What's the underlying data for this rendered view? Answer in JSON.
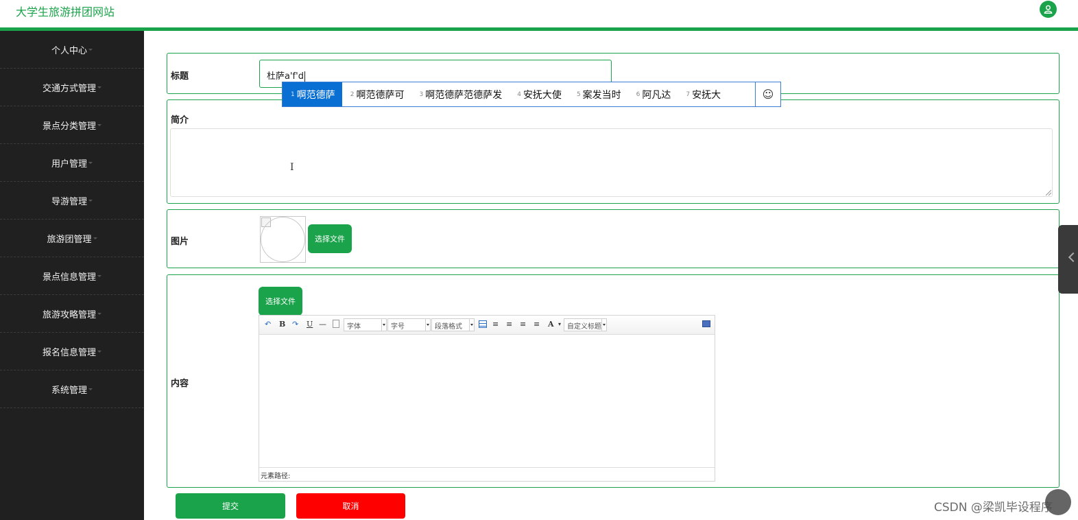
{
  "header": {
    "site_title": "大学生旅游拼团网站",
    "avatar_icon": "user-icon",
    "accent": "#1aa34a"
  },
  "sidebar": {
    "items": [
      {
        "label": "个人中心"
      },
      {
        "label": "交通方式管理"
      },
      {
        "label": "景点分类管理"
      },
      {
        "label": "用户管理"
      },
      {
        "label": "导游管理"
      },
      {
        "label": "旅游团管理"
      },
      {
        "label": "景点信息管理"
      },
      {
        "label": "旅游攻略管理"
      },
      {
        "label": "报名信息管理"
      },
      {
        "label": "系统管理"
      }
    ]
  },
  "form": {
    "title": {
      "label": "标题",
      "value_committed": "杜萨",
      "value_composing": "a'f'd"
    },
    "intro": {
      "label": "简介",
      "value": ""
    },
    "image": {
      "label": "图片",
      "button": "选择文件"
    },
    "content": {
      "label": "内容",
      "upload_button": "选择文件",
      "toolbar": {
        "bold": "B",
        "underline": "U",
        "hr": "—",
        "font_family": "字体",
        "font_size": "字号",
        "paragraph": "段落格式",
        "font_color": "A",
        "custom_heading": "自定义标题"
      },
      "element_path": "元素路径:"
    }
  },
  "ime": {
    "candidates": [
      {
        "num": "1",
        "text": "啊范德萨"
      },
      {
        "num": "2",
        "text": "啊范德萨可"
      },
      {
        "num": "3",
        "text": "啊范德萨范德萨发"
      },
      {
        "num": "4",
        "text": "安抚大使"
      },
      {
        "num": "5",
        "text": "案发当时"
      },
      {
        "num": "6",
        "text": "阿凡达"
      },
      {
        "num": "7",
        "text": "安抚大"
      }
    ],
    "emoji_icon": "☺"
  },
  "actions": {
    "submit": "提交",
    "cancel": "取消"
  },
  "watermark": "CSDN @梁凯毕设程序"
}
